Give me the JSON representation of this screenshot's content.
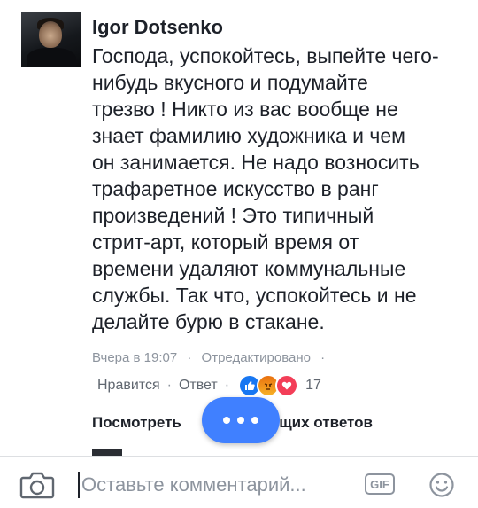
{
  "comment": {
    "author": "Igor Dotsenko",
    "text": "Господа, успокойтесь, выпейте чего-\nнибудь вкусного и подумайте\nтрезво !  Никто из вас вообще  не\nзнает  фамилию  художника и чем\nон  занимается. Не  надо  возносить\nтрафаретное  искусство  в  ранг\nпроизведений !  Это  типичный\nстрит-арт,  который  время  от\nвремени  удаляют  коммунальные\nслужбы. Так  что,  успокойтесь  и  не\nделайте  бурю  в  стакане.",
    "timestamp": "Вчера в 19:07",
    "edited_label": "Отредактировано",
    "separator": "·",
    "like_label": "Нравится",
    "reply_label": "Ответ",
    "reaction_count": "17",
    "reactions": [
      "like-icon",
      "angry-icon",
      "love-icon"
    ]
  },
  "view_more": {
    "left_text": "Посмотреть",
    "right_text": "дущих ответов"
  },
  "composer": {
    "placeholder": "Оставьте комментарий...",
    "gif_label": "GIF"
  },
  "colors": {
    "accent": "#4080ff",
    "like": "#1877f2",
    "love": "#f33e58",
    "meta_text": "#8d949e"
  }
}
